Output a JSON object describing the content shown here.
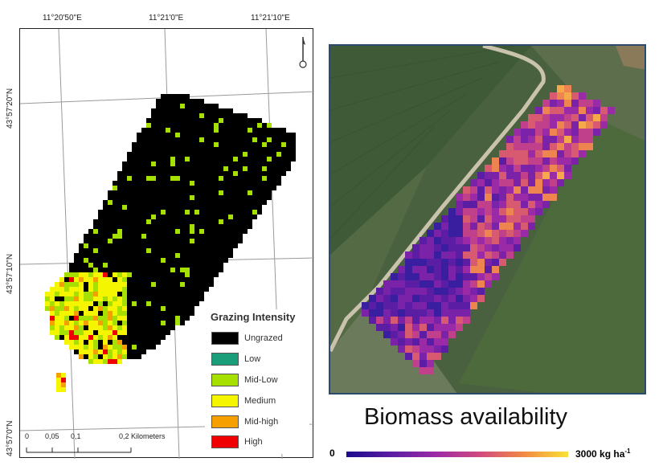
{
  "left_map": {
    "coords_top": [
      "11°20'50\"E",
      "11°21'0\"E",
      "11°21'10\"E"
    ],
    "coords_left": [
      "43°57'20\"N",
      "43°57'10\"N",
      "43°57'0\"N"
    ],
    "legend": {
      "title": "Grazing Intensity",
      "items": [
        {
          "label": "Ungrazed",
          "color": "#000000"
        },
        {
          "label": "Low",
          "color": "#1a9e7a"
        },
        {
          "label": "Mid-Low",
          "color": "#a6e000"
        },
        {
          "label": "Medium",
          "color": "#f5f500"
        },
        {
          "label": "Mid-high",
          "color": "#f5a000"
        },
        {
          "label": "High",
          "color": "#f00000"
        }
      ]
    },
    "scale_bar": {
      "labels": [
        "0",
        "0,05",
        "0,1",
        "0,2 Kilometers"
      ]
    },
    "north_arrow_icon": "north-arrow-icon"
  },
  "right_map": {
    "title": "Biomass availability",
    "colorbar": {
      "min_label": "0",
      "max_label": "3000 kg ha",
      "max_superscript": "-1",
      "colors": [
        "#1b0c8c",
        "#9b2aa6",
        "#f28a45",
        "#f9e234"
      ]
    }
  }
}
